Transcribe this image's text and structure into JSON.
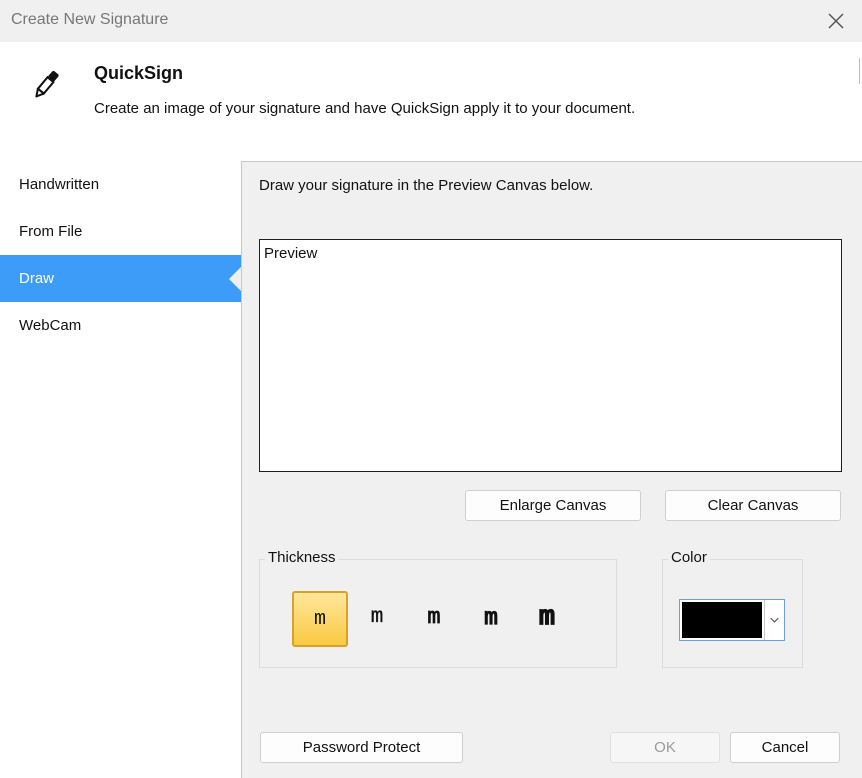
{
  "window": {
    "title": "Create New Signature"
  },
  "header": {
    "app_name": "QuickSign",
    "description": "Create an image of your signature and have QuickSign apply it to your document.",
    "icon": "pen-icon"
  },
  "sidebar": {
    "items": [
      {
        "label": "Handwritten",
        "active": false
      },
      {
        "label": "From File",
        "active": false
      },
      {
        "label": "Draw",
        "active": true
      },
      {
        "label": "WebCam",
        "active": false
      }
    ]
  },
  "draw": {
    "instruction": "Draw your signature in the Preview Canvas below.",
    "canvas_label": "Preview",
    "enlarge_label": "Enlarge Canvas",
    "clear_label": "Clear Canvas"
  },
  "thickness": {
    "label": "Thickness",
    "options": [
      "m",
      "m",
      "m",
      "m",
      "m"
    ],
    "selected_index": 0
  },
  "color": {
    "label": "Color",
    "selected": "#000000"
  },
  "footer": {
    "password_label": "Password Protect",
    "ok_label": "OK",
    "cancel_label": "Cancel"
  },
  "accent_color": "#3d9cf7"
}
